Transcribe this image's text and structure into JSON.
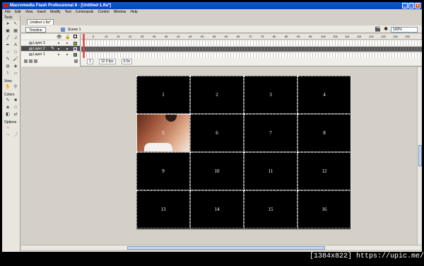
{
  "window": {
    "title": "Macromedia Flash Professional 8 - [Untitled-1.fla*]",
    "controls": [
      "_",
      "□",
      "x"
    ]
  },
  "menu": [
    "File",
    "Edit",
    "View",
    "Insert",
    "Modify",
    "Text",
    "Commands",
    "Control",
    "Window",
    "Help"
  ],
  "tools_panel": {
    "header": "Tools",
    "view_label": "View",
    "colors_label": "Colors",
    "options_label": "Options"
  },
  "document": {
    "tab": "Untitled-1.fla*",
    "timeline_button": "Timeline",
    "scene": "Scene 1",
    "zoom": "100%"
  },
  "timeline": {
    "layers": [
      {
        "name": "Layer 3",
        "selected": false
      },
      {
        "name": "Layer 2",
        "selected": true
      },
      {
        "name": "Layer 1",
        "selected": false
      }
    ],
    "ruler_ticks": [
      "5",
      "10",
      "15",
      "20",
      "25",
      "30",
      "35",
      "40",
      "45",
      "50",
      "55",
      "60",
      "65",
      "70",
      "75",
      "80",
      "85",
      "90",
      "95",
      "100",
      "105",
      "110",
      "115",
      "120",
      "125",
      "130",
      "135"
    ],
    "status": {
      "frame": "1",
      "fps": "12.0 fps",
      "time": "0.0s"
    }
  },
  "stage": {
    "tiles": [
      "1",
      "2",
      "3",
      "4",
      "5",
      "6",
      "7",
      "8",
      "9",
      "10",
      "11",
      "12",
      "13",
      "14",
      "15",
      "16"
    ],
    "photo_tile": "5"
  },
  "watermark": "[1384x822] https://upic.me/"
}
